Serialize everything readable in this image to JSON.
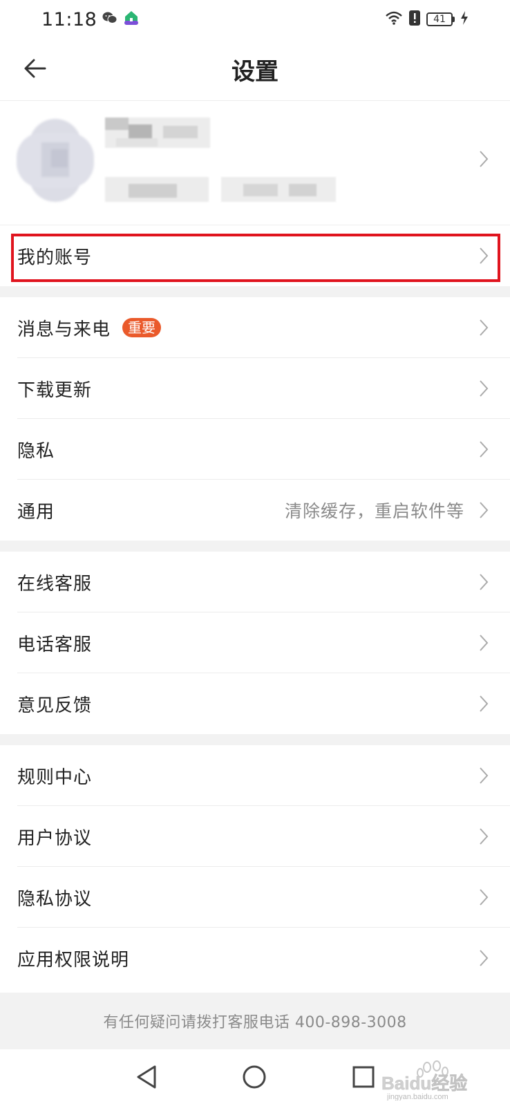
{
  "status_bar": {
    "time": "11:18",
    "battery_level": "41",
    "icons": [
      "wechat-icon",
      "home-app-icon",
      "wifi-icon",
      "alert-icon",
      "battery-icon",
      "charging-icon"
    ]
  },
  "header": {
    "title": "设置",
    "back_icon": "arrow-left-icon"
  },
  "account": {
    "label": "我的账号"
  },
  "groups": [
    {
      "items": [
        {
          "label": "消息与来电",
          "badge": "重要"
        },
        {
          "label": "下载更新"
        },
        {
          "label": "隐私"
        },
        {
          "label": "通用",
          "sublabel": "清除缓存，重启软件等"
        }
      ]
    },
    {
      "items": [
        {
          "label": "在线客服"
        },
        {
          "label": "电话客服"
        },
        {
          "label": "意见反馈"
        }
      ]
    },
    {
      "items": [
        {
          "label": "规则中心"
        },
        {
          "label": "用户协议"
        },
        {
          "label": "隐私协议"
        },
        {
          "label": "应用权限说明"
        }
      ]
    }
  ],
  "footer": {
    "text": "有任何疑问请拨打客服电话 400-898-3008"
  },
  "watermark": {
    "text": "Baidu经验",
    "subtext": "jingyan.baidu.com"
  },
  "colors": {
    "highlight_border": "#e0141e",
    "badge": "#ea5a2b",
    "separator": "#f2f2f2",
    "secondary_text": "#8a8a8a"
  }
}
